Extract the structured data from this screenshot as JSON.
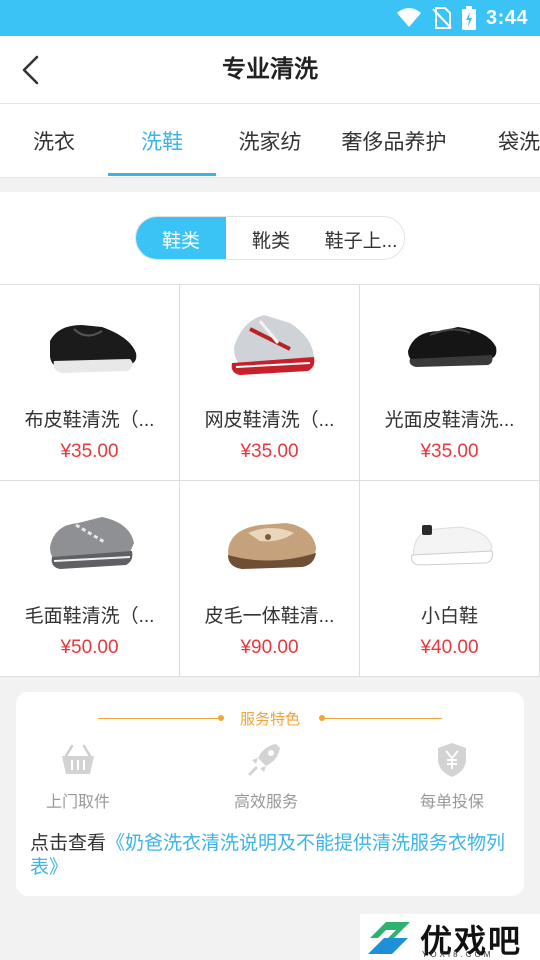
{
  "status_bar": {
    "time": "3:44"
  },
  "header": {
    "title": "专业清洗"
  },
  "tabs": [
    {
      "label": "洗衣"
    },
    {
      "label": "洗鞋"
    },
    {
      "label": "洗家纺"
    },
    {
      "label": "奢侈品养护"
    },
    {
      "label": "袋洗"
    }
  ],
  "segments": [
    {
      "label": "鞋类"
    },
    {
      "label": "靴类"
    },
    {
      "label": "鞋子上..."
    }
  ],
  "products": [
    {
      "name": "布皮鞋清洗（...",
      "price": "¥35.00"
    },
    {
      "name": "网皮鞋清洗（...",
      "price": "¥35.00"
    },
    {
      "name": "光面皮鞋清洗...",
      "price": "¥35.00"
    },
    {
      "name": "毛面鞋清洗（...",
      "price": "¥50.00"
    },
    {
      "name": "皮毛一体鞋清...",
      "price": "¥90.00"
    },
    {
      "name": "小白鞋",
      "price": "¥40.00"
    }
  ],
  "service": {
    "title": "服务特色",
    "features": [
      {
        "label": "上门取件",
        "icon": "basket-icon"
      },
      {
        "label": "高效服务",
        "icon": "rocket-icon"
      },
      {
        "label": "每单投保",
        "icon": "shield-yen-icon"
      }
    ],
    "link_prefix": "点击查看",
    "link_text": "《奶爸洗衣清洗说明及不能提供清洗服务衣物列表》"
  },
  "watermark": {
    "brand": "优戏吧",
    "domain": "YOXI8.COM"
  },
  "colors": {
    "accent": "#3bc3f6",
    "price": "#e8383d",
    "service": "#f2a33a"
  }
}
